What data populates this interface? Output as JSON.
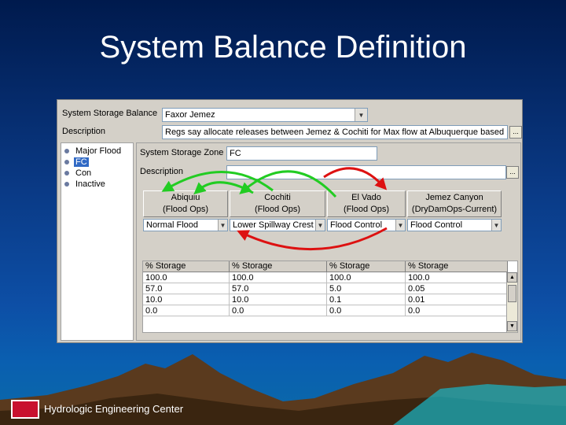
{
  "slide": {
    "title": "System Balance Definition",
    "footer": "Hydrologic Engineering Center"
  },
  "form": {
    "storage_balance_label": "System Storage Balance",
    "storage_balance_value": "Faxor Jemez",
    "description_label": "Description",
    "description_value": "Regs say allocate releases between Jemez & Cochiti for Max flow at Albuquerque based",
    "zone_label": "System Storage Zone",
    "zone_value": "FC",
    "zone_description_label": "Description",
    "zone_description_value": ""
  },
  "zones": [
    "Major Flood",
    "FC",
    "Con",
    "Inactive"
  ],
  "reservoirs": [
    {
      "name": "Abiquiu",
      "ops": "(Flood Ops)",
      "rule": "Normal Flood"
    },
    {
      "name": "Cochiti",
      "ops": "(Flood Ops)",
      "rule": "Lower Spillway Crest"
    },
    {
      "name": "El Vado",
      "ops": "(Flood Ops)",
      "rule": "Flood Control"
    },
    {
      "name": "Jemez Canyon",
      "ops": "(DryDamOps-Current)",
      "rule": "Flood Control"
    }
  ],
  "table": {
    "headers": [
      "% Storage",
      "% Storage",
      "% Storage",
      "% Storage"
    ],
    "rows": [
      [
        "100.0",
        "100.0",
        "100.0",
        "100.0"
      ],
      [
        "57.0",
        "57.0",
        "5.0",
        "0.05"
      ],
      [
        "10.0",
        "10.0",
        "0.1",
        "0.01"
      ],
      [
        "0.0",
        "0.0",
        "0.0",
        "0.0"
      ]
    ]
  },
  "colors": {
    "green_arrow": "#22cc22",
    "red_arrow": "#dd1111",
    "selection": "#316ac5"
  }
}
